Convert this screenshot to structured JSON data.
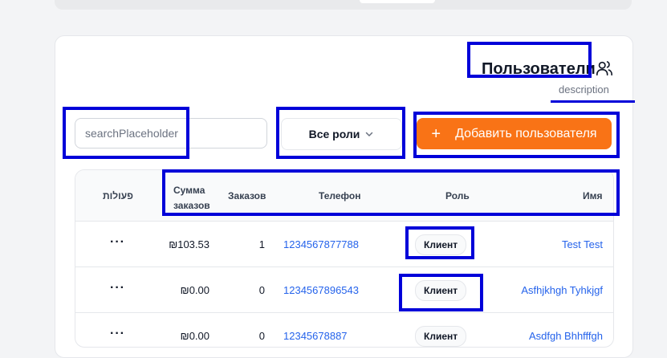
{
  "header": {
    "title": "Пользователи",
    "description": "description",
    "title_icon": "users-icon"
  },
  "toolbar": {
    "search_placeholder": "searchPlaceholder",
    "roles_filter": "Все роли",
    "roles_icon": "chevron-down-icon",
    "add_button_label": "Добавить пользователя",
    "add_button_icon": "+",
    "accent_color": "#f97316"
  },
  "table": {
    "columns": {
      "actions": "פעולות",
      "total_orders_line1": "Сумма",
      "total_orders_line2": "заказов",
      "orders": "Заказов",
      "phone": "Телефон",
      "role": "Роль",
      "name": "Имя"
    },
    "rows": [
      {
        "actions": "···",
        "total": "₪103.53",
        "orders": "1",
        "phone": "1234567877788",
        "role": "Клиент",
        "name": "Test Test"
      },
      {
        "actions": "···",
        "total": "₪0.00",
        "orders": "0",
        "phone": "1234567896543",
        "role": "Клиент",
        "name": "Asfhjkhgh Tyhkjgf"
      },
      {
        "actions": "···",
        "total": "₪0.00",
        "orders": "0",
        "phone": "12345678887",
        "role": "Клиент",
        "name": "Asdfgh Bhhfffgh"
      }
    ]
  }
}
